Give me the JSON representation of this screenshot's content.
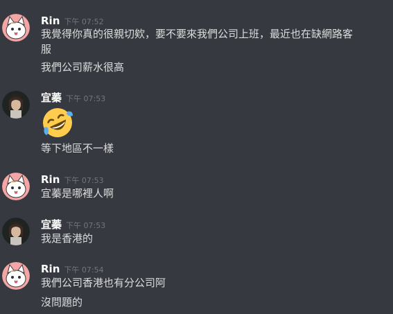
{
  "messages": [
    {
      "author": "Rin",
      "time": "下午 07:52",
      "avatar_icon": "cat-avatar-icon",
      "lines": [
        "我覺得你真的很親切欸，要不要來我們公司上班，最近也在缺網路客",
        "服",
        "我們公司薪水很高"
      ]
    },
    {
      "author": "宜蓁",
      "time": "下午 07:53",
      "avatar_icon": "person-photo-avatar-icon",
      "emoji": "rofl-emoji-icon",
      "lines": [
        "等下地區不一樣"
      ]
    },
    {
      "author": "Rin",
      "time": "下午 07:53",
      "avatar_icon": "cat-avatar-icon",
      "lines": [
        "宜蓁是哪裡人啊"
      ]
    },
    {
      "author": "宜蓁",
      "time": "下午 07:53",
      "avatar_icon": "person-photo-avatar-icon",
      "lines": [
        "我是香港的"
      ]
    },
    {
      "author": "Rin",
      "time": "下午 07:54",
      "avatar_icon": "cat-avatar-icon",
      "lines": [
        "我們公司香港也有分公司阿",
        "沒問題的"
      ]
    }
  ],
  "colors": {
    "background": "#36393f",
    "username": "#ffffff",
    "text": "#dcddde",
    "timestamp": "#72767d"
  }
}
